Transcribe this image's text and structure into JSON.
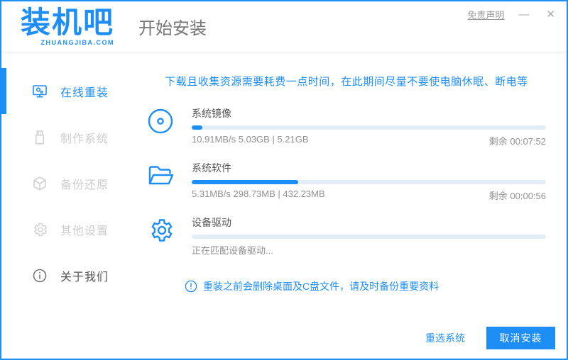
{
  "window": {
    "logo_title": "装机吧",
    "logo_subtitle": "ZHUANGJIBA.COM",
    "page_title": "开始安装",
    "disclaimer_link": "免责声明",
    "minimize_glyph": "—",
    "close_glyph": "✕"
  },
  "colors": {
    "primary": "#1E8EF7",
    "progress_track": "#E3EDF8"
  },
  "sidebar": {
    "items": [
      {
        "label": "在线重装",
        "icon": "monitor-icon",
        "active": true
      },
      {
        "label": "制作系统",
        "icon": "usb-icon",
        "active": false
      },
      {
        "label": "备份还原",
        "icon": "backup-icon",
        "active": false
      },
      {
        "label": "其他设置",
        "icon": "gear-icon",
        "active": false
      },
      {
        "label": "关于我们",
        "icon": "info-icon",
        "active": false
      }
    ]
  },
  "main": {
    "notice": "下载且收集资源需要耗费一点时间，在此期间尽量不要使电脑休眠、断电等",
    "tasks": [
      {
        "name": "系统镜像",
        "progress_percent": 3,
        "stats": "10.91MB/s 5.03GB | 5.21GB",
        "remaining": "剩余 00:07:52"
      },
      {
        "name": "系统软件",
        "progress_percent": 30,
        "stats": "5.31MB/s 298.73MB | 432.23MB",
        "remaining": "剩余 00:00:56"
      },
      {
        "name": "设备驱动",
        "progress_percent": 0,
        "stats": "正在匹配设备驱动...",
        "remaining": ""
      }
    ],
    "warning_note": "重装之前会删除桌面及C盘文件，请及时备份重要资料"
  },
  "footer": {
    "reselect_label": "重选系统",
    "cancel_label": "取消安装"
  }
}
